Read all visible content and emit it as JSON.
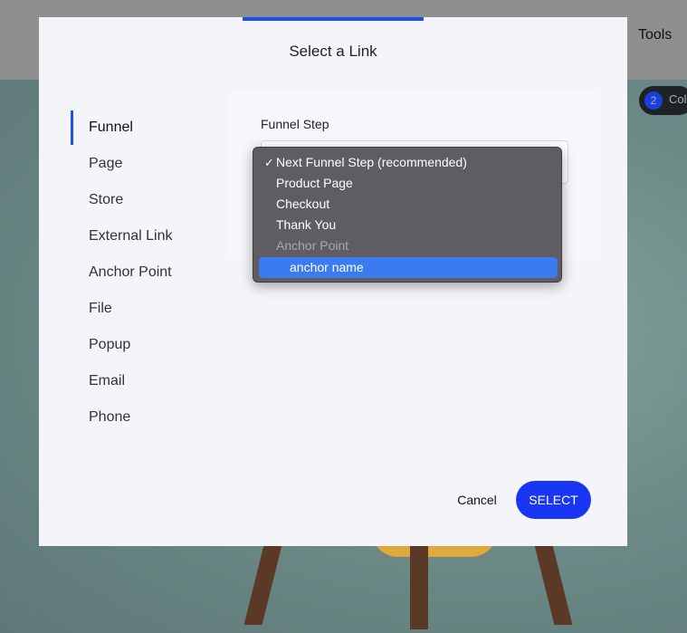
{
  "background": {
    "toolbar_label": "Tools",
    "badge_count": "2",
    "badge_text": "Col"
  },
  "modal": {
    "title": "Select a Link",
    "accent_color": "#1c4ff2"
  },
  "sidebar": {
    "items": [
      {
        "label": "Funnel",
        "active": true
      },
      {
        "label": "Page"
      },
      {
        "label": "Store"
      },
      {
        "label": "External Link"
      },
      {
        "label": "Anchor Point"
      },
      {
        "label": "File"
      },
      {
        "label": "Popup"
      },
      {
        "label": "Email"
      },
      {
        "label": "Phone"
      }
    ]
  },
  "funnel_step": {
    "label": "Funnel Step",
    "options": [
      {
        "label": "Next Funnel Step (recommended)",
        "checked": true
      },
      {
        "label": "Product Page"
      },
      {
        "label": "Checkout"
      },
      {
        "label": "Thank You"
      },
      {
        "label": "Anchor Point",
        "disabled": true
      },
      {
        "label": "anchor name",
        "highlighted": true
      }
    ]
  },
  "actions": {
    "cancel_label": "Cancel",
    "select_label": "SELECT"
  }
}
